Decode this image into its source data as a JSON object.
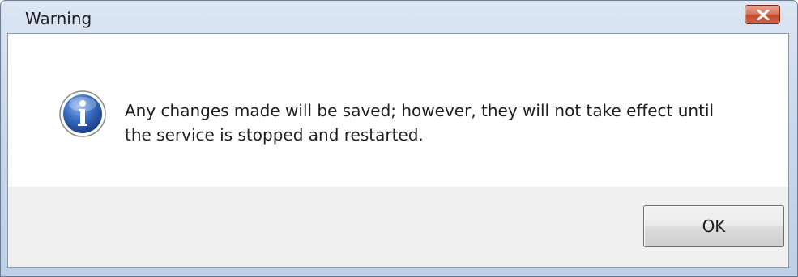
{
  "window": {
    "title": "Warning"
  },
  "message": {
    "line1": "Any changes made will be saved; however, they will not take effect until",
    "line2": "the service is stopped and restarted."
  },
  "buttons": {
    "ok_label": "OK"
  },
  "icons": {
    "message_icon": "info-icon",
    "close_icon": "close-icon"
  },
  "colors": {
    "close_button": "#c4492c",
    "info_icon": "#2a5caa"
  }
}
